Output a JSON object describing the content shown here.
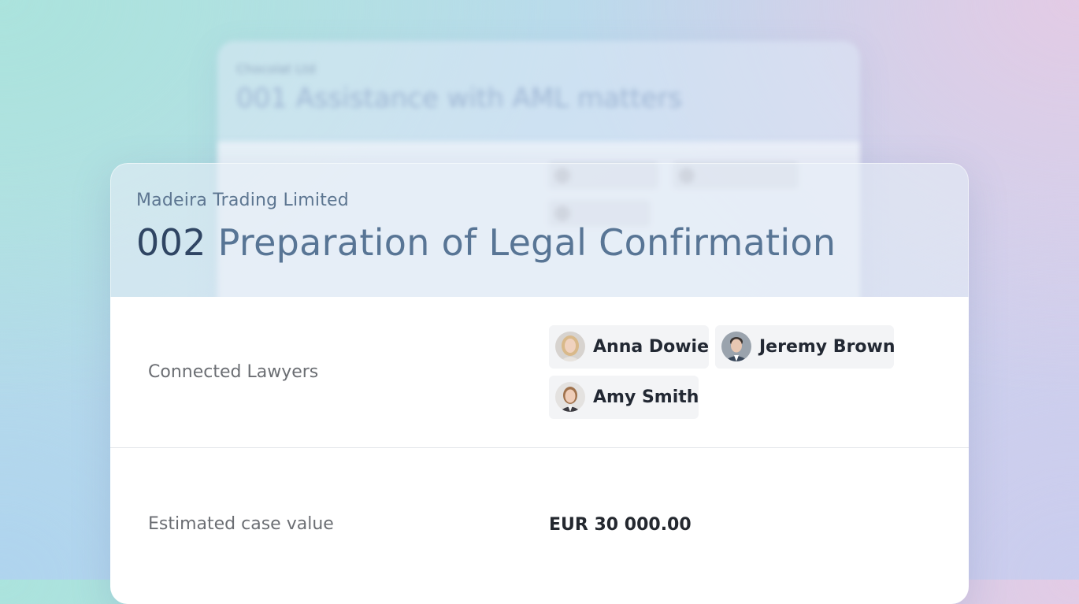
{
  "background_card": {
    "client": "Chocolat Ltd",
    "title": "001 Assistance with AML matters"
  },
  "case": {
    "client_name": "Madeira Trading Limited",
    "number": "002",
    "title": "Preparation of Legal Confirmation"
  },
  "lawyers": {
    "label": "Connected Lawyers",
    "items": [
      {
        "name": "Anna Dowie",
        "avatar": "avatar-anna-icon"
      },
      {
        "name": "Jeremy Brown",
        "avatar": "avatar-jeremy-icon"
      },
      {
        "name": "Amy Smith",
        "avatar": "avatar-amy-icon"
      }
    ]
  },
  "case_value": {
    "label": "Estimated case value",
    "value": "EUR 30 000.00"
  },
  "colors": {
    "title_number": "#2f4563",
    "title_text": "#587595",
    "client_text": "#5d7691",
    "chip_background": "#f3f4f6"
  }
}
